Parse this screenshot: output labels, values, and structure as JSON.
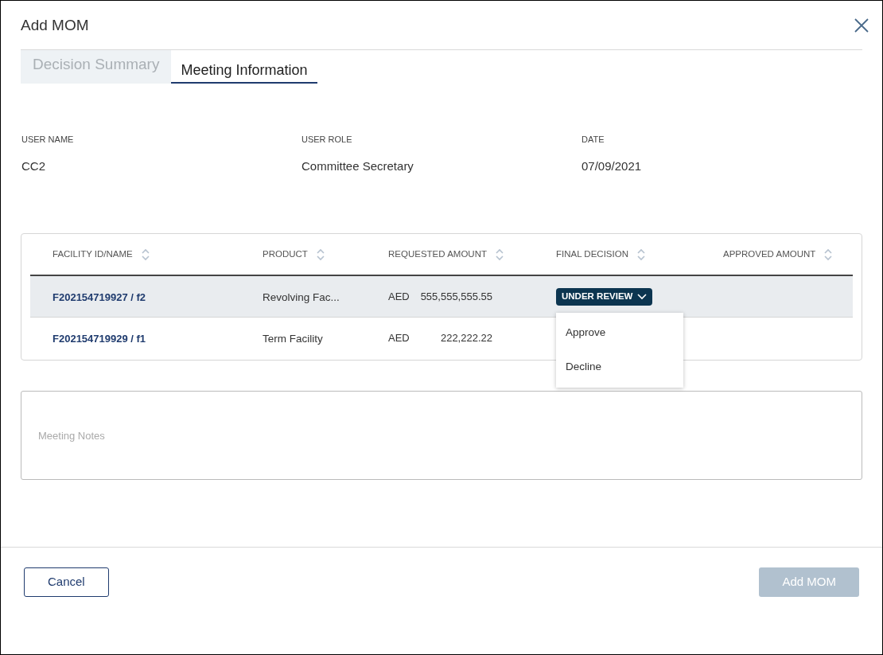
{
  "dialog": {
    "title": "Add MOM"
  },
  "tabs": [
    {
      "label": "Decision Summary",
      "selected": false
    },
    {
      "label": "Meeting Information",
      "selected": true
    }
  ],
  "info": [
    {
      "label": "USER NAME",
      "value": "CC2"
    },
    {
      "label": "USER ROLE",
      "value": "Committee Secretary"
    },
    {
      "label": "DATE",
      "value": "07/09/2021"
    }
  ],
  "table": {
    "columns": [
      "FACILITY ID/NAME",
      "PRODUCT",
      "REQUESTED AMOUNT",
      "FINAL DECISION",
      "APPROVED AMOUNT"
    ],
    "rows": [
      {
        "selected": true,
        "facility": "F202154719927 / f2",
        "product": "Revolving Fac...",
        "currency": "AED",
        "amount": "555,555,555.55",
        "final_decision": {
          "label": "UNDER REVIEW",
          "open": true,
          "options": [
            "Approve",
            "Decline"
          ]
        }
      },
      {
        "selected": false,
        "facility": "F202154719929 / f1",
        "product": "Term Facility",
        "currency": "AED",
        "amount": "222,222.22"
      }
    ]
  },
  "notes": {
    "placeholder": "Meeting Notes"
  },
  "buttons": [
    {
      "label": "Cancel",
      "kind": "secondary",
      "disabled": false
    },
    {
      "label": "Add MOM",
      "kind": "primary",
      "disabled": true
    }
  ]
}
